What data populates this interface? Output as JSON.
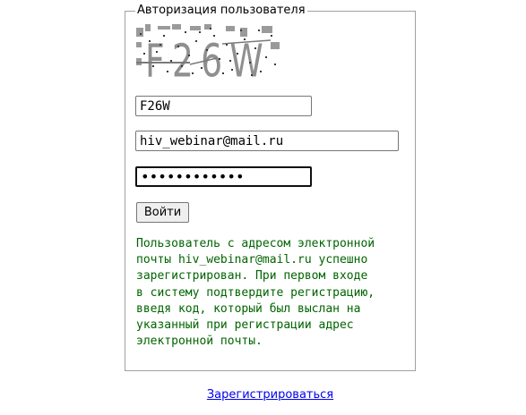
{
  "auth": {
    "legend": "Авторизация пользователя",
    "captcha_text": "F26W",
    "captcha_value": "F26W",
    "email_value": "hiv_webinar@mail.ru",
    "password_value": "••••••••••••",
    "login_label": "Войти",
    "message": "Пользователь с адресом электронной\nпочты hiv_webinar@mail.ru успешно\nзарегистрирован. При первом входе\nв систему подтвердите регистрацию,\nвведя код, который был выслан на\nуказанный при регистрации адрес\nэлектронной почты."
  },
  "register_link": "Зарегистрироваться",
  "colors": {
    "message": "#006400",
    "link": "#0000ee",
    "border": "#a0a0a0"
  }
}
